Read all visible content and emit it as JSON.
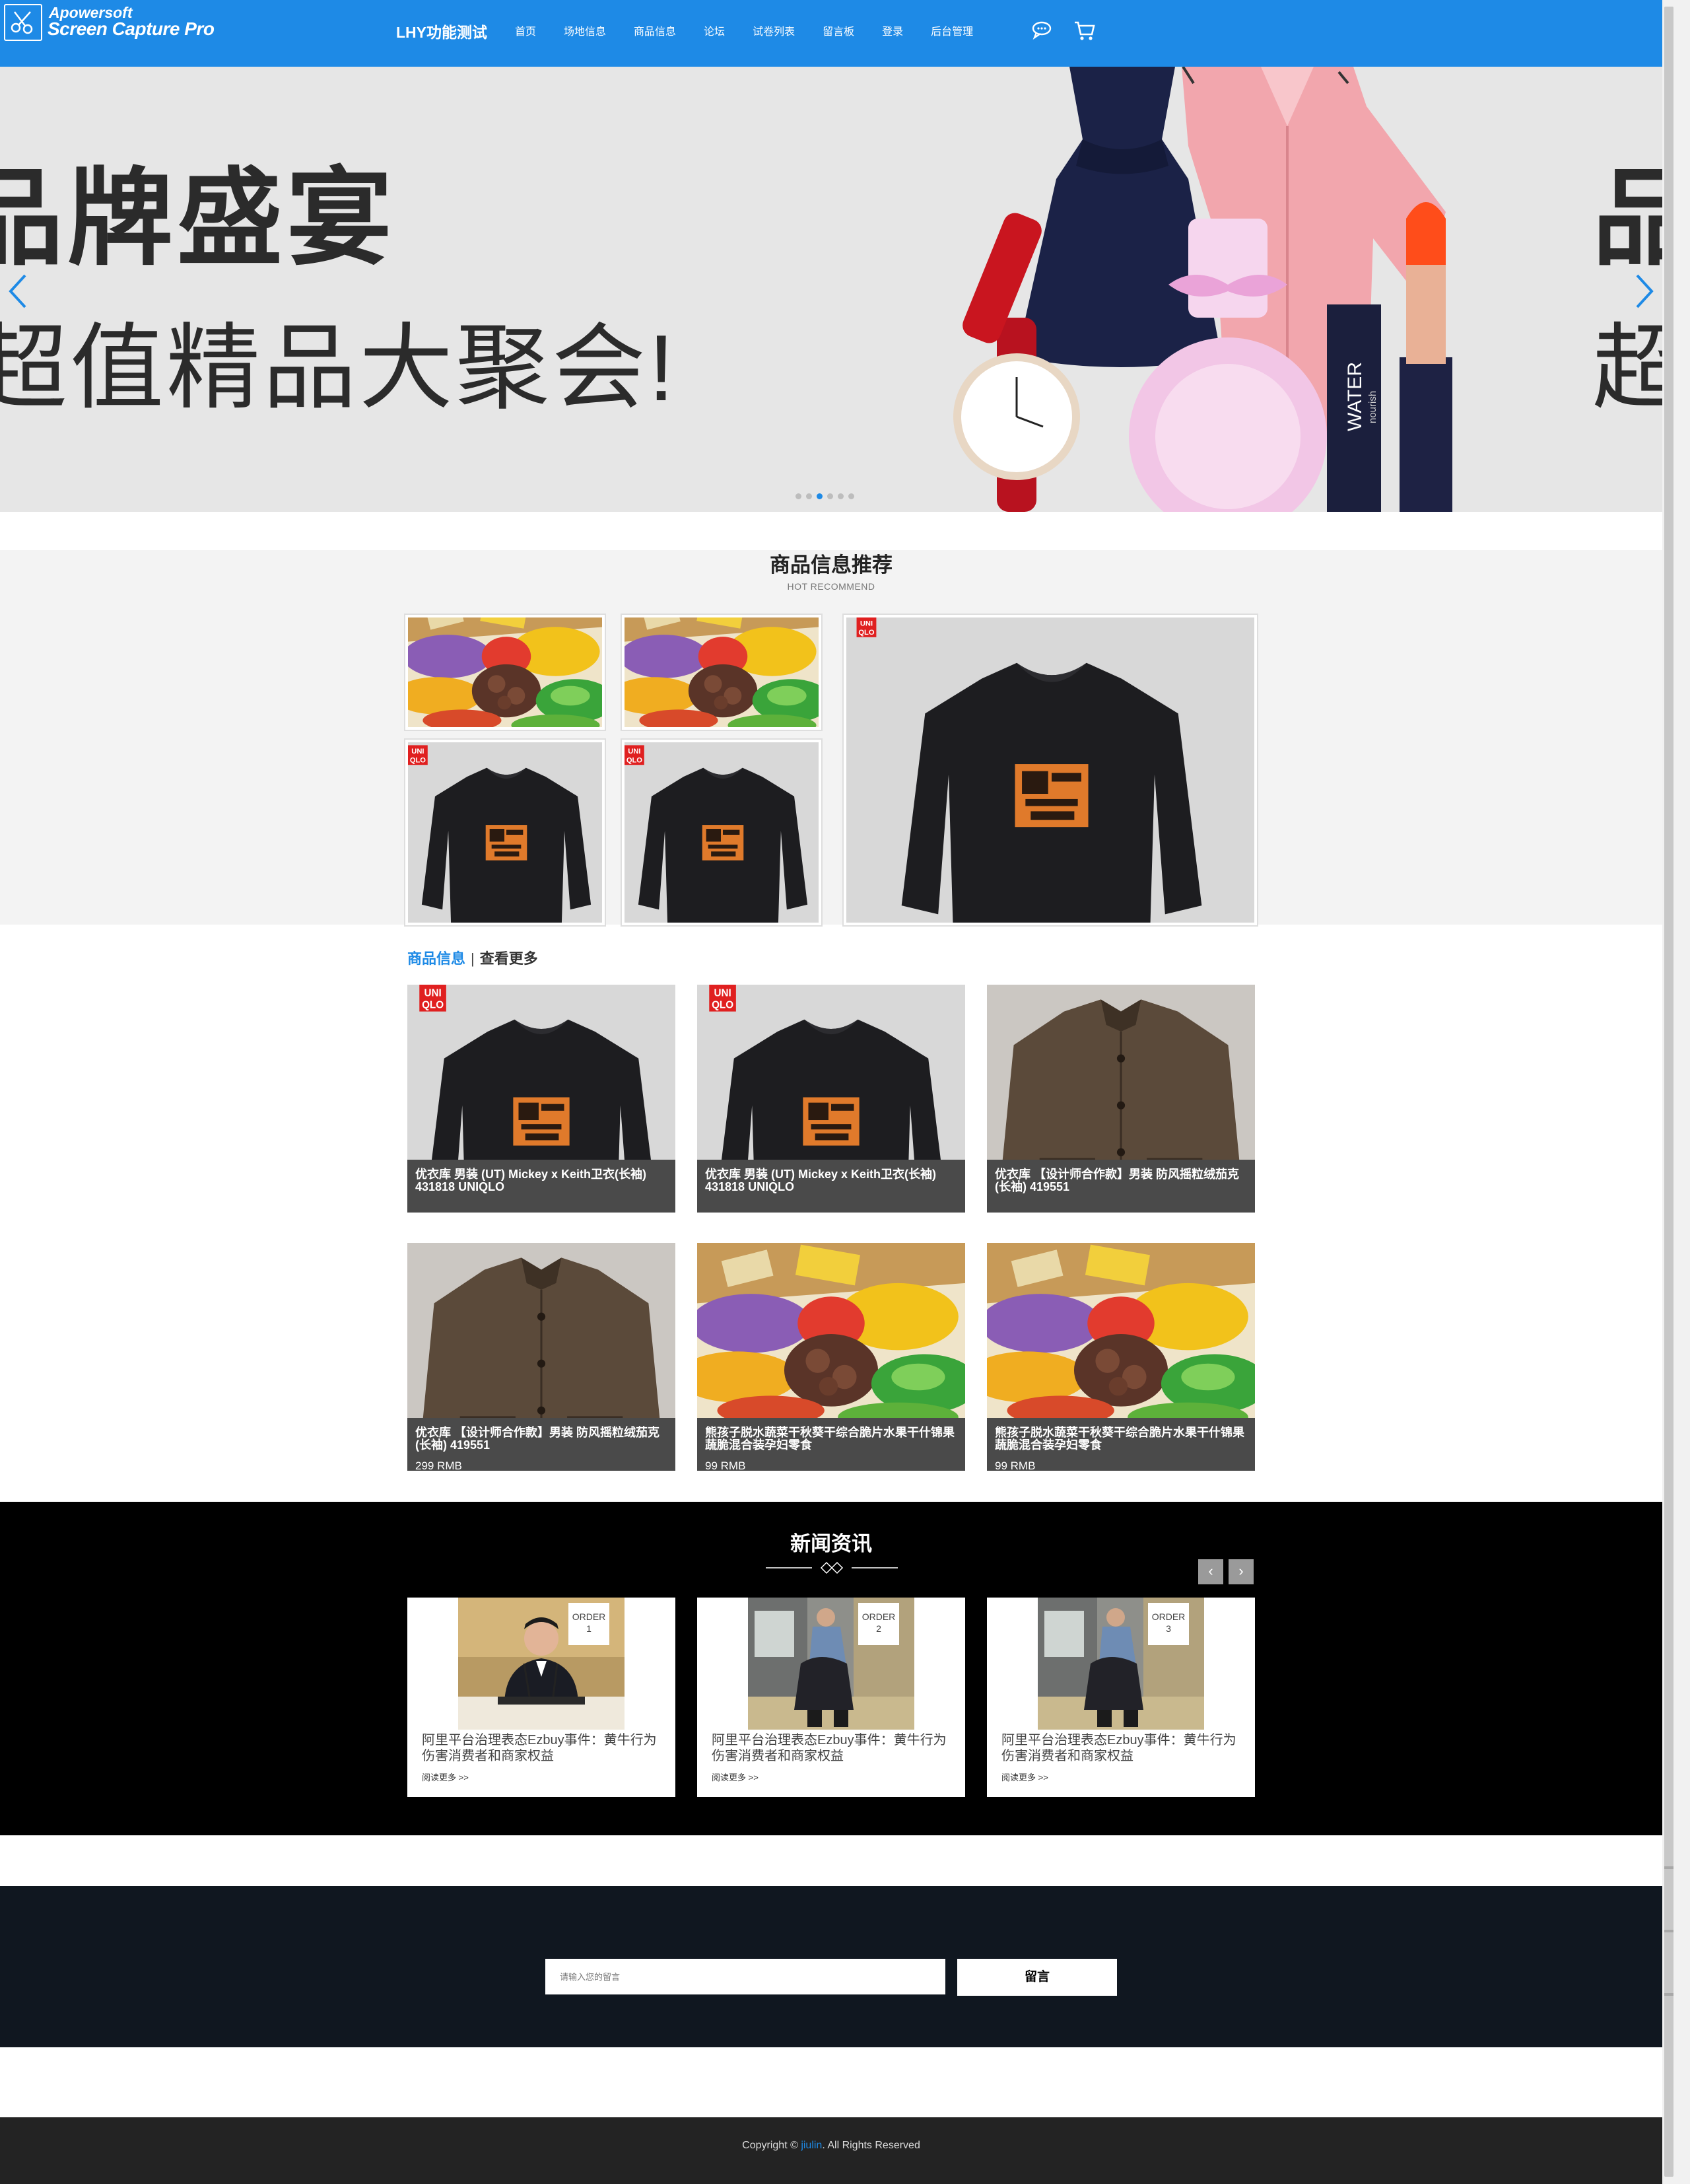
{
  "watermark": {
    "line1": "Apowersoft",
    "line2": "Screen Capture Pro"
  },
  "header": {
    "brand": "LHY功能测试",
    "nav": [
      "首页",
      "场地信息",
      "商品信息",
      "论坛",
      "试卷列表",
      "留言板",
      "登录",
      "后台管理"
    ],
    "icons": [
      "chat-icon",
      "cart-icon"
    ]
  },
  "hero": {
    "line1": "品牌盛宴",
    "line2": "超值精品大聚会!",
    "product_label": "WATER",
    "product_sublabel": "nourish",
    "dots": 6,
    "active_dot": 3
  },
  "recommend": {
    "title": "商品信息推荐",
    "subtitle": "HOT RECOMMEND",
    "brand_tag": [
      "UNI",
      "QLO"
    ]
  },
  "products": {
    "tab_active": "商品信息",
    "tab_more": "查看更多",
    "items": [
      {
        "title": "优衣库 男装 (UT) Mickey x Keith卫衣(长袖) 431818 UNIQLO",
        "price": "",
        "kind": "sweater"
      },
      {
        "title": "优衣库 男装 (UT) Mickey x Keith卫衣(长袖) 431818 UNIQLO",
        "price": "",
        "kind": "sweater"
      },
      {
        "title": "优衣库 【设计师合作款】男装 防风摇粒绒茄克(长袖) 419551",
        "price": "",
        "kind": "jacket"
      },
      {
        "title": "优衣库 【设计师合作款】男装 防风摇粒绒茄克(长袖) 419551",
        "price": "299 RMB",
        "kind": "jacket"
      },
      {
        "title": "熊孩子脱水蔬菜干秋葵干综合脆片水果干什锦果蔬脆混合装孕妇零食",
        "price": "99 RMB",
        "kind": "fruit"
      },
      {
        "title": "熊孩子脱水蔬菜干秋葵干综合脆片水果干什锦果蔬脆混合装孕妇零食",
        "price": "99 RMB",
        "kind": "fruit"
      }
    ]
  },
  "news": {
    "title": "新闻资讯",
    "items": [
      {
        "order_label": "ORDER",
        "order_num": "1",
        "text": "阿里平台治理表态Ezbuy事件：黄牛行为伤害消费者和商家权益",
        "more": "阅读更多 >>"
      },
      {
        "order_label": "ORDER",
        "order_num": "2",
        "text": "阿里平台治理表态Ezbuy事件：黄牛行为伤害消费者和商家权益",
        "more": "阅读更多 >>"
      },
      {
        "order_label": "ORDER",
        "order_num": "3",
        "text": "阿里平台治理表态Ezbuy事件：黄牛行为伤害消费者和商家权益",
        "more": "阅读更多 >>"
      }
    ]
  },
  "message": {
    "placeholder": "请输入您的留言",
    "button": "留言"
  },
  "footer": {
    "prefix": "Copyright © ",
    "link": "jiulin",
    "suffix": ". All Rights Reserved"
  },
  "colors": {
    "accent": "#1e8ae6",
    "header_bg": "#1e8ae6",
    "news_bg": "#000000",
    "message_bg": "#101720",
    "footer_bg": "#232323"
  }
}
